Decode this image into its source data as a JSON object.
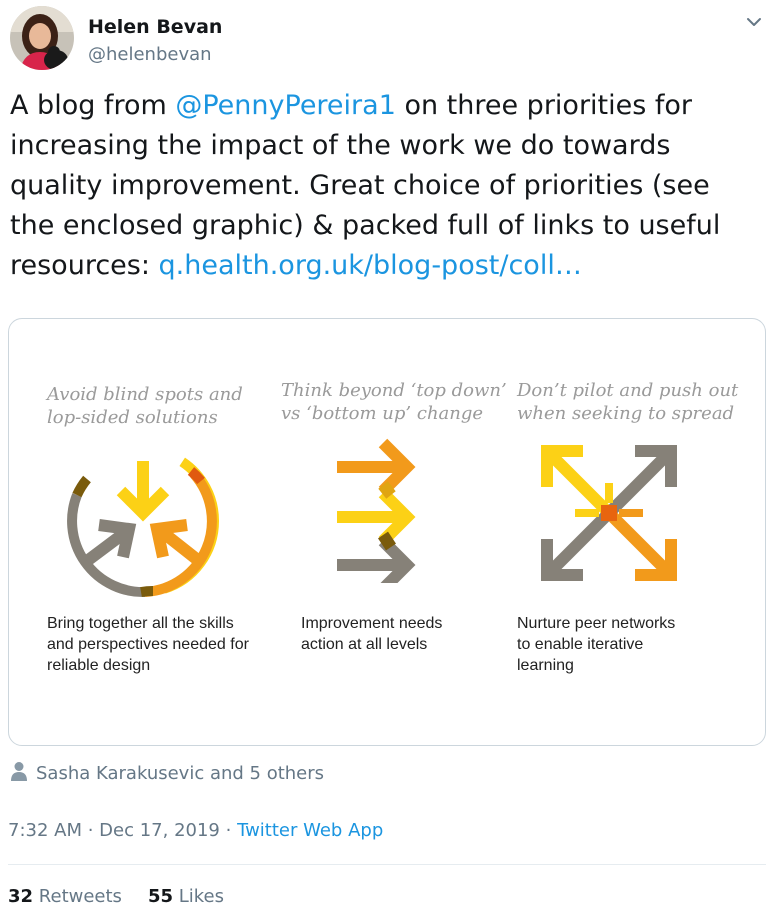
{
  "user": {
    "name": "Helen Bevan",
    "handle": "@helenbevan"
  },
  "tweet": {
    "text_1": "A blog from ",
    "mention": "@PennyPereira1",
    "text_2": " on three priorities for increasing the impact of the work we do towards quality improvement. Great choice of priorities (see the enclosed graphic) & packed full of links to useful resources: ",
    "link": "q.health.org.uk/blog-post/coll…"
  },
  "graphic": {
    "columns": [
      {
        "title_line1": "Avoid blind spots and",
        "title_line2": "lop-sided solutions",
        "caption_line1": "Bring together all the skills",
        "caption_line2": "and perspectives needed for",
        "caption_line3": "reliable design"
      },
      {
        "title_line1": "Think beyond ‘top down’",
        "title_line2": "vs ‘bottom up’ change",
        "caption_line1": "Improvement needs",
        "caption_line2": "action at all levels"
      },
      {
        "title_line1": "Don’t pilot and push out",
        "title_line2": "when seeking to spread",
        "caption_line1": "Nurture peer networks",
        "caption_line2": "to enable iterative",
        "caption_line3": "learning"
      }
    ],
    "colors": {
      "yellow": "#fcd116",
      "orange": "#f29a1b",
      "grey": "#868178",
      "brown": "#7a5b0c"
    }
  },
  "likers": {
    "icon": "person-icon",
    "text": "Sasha Karakusevic and 5 others"
  },
  "meta": {
    "time": "7:32 AM",
    "separator": " · ",
    "date": "Dec 17, 2019",
    "separator2": " · ",
    "app": "Twitter Web App"
  },
  "stats": {
    "retweets_count": "32",
    "retweets_label": "Retweets",
    "likes_count": "55",
    "likes_label": "Likes"
  }
}
